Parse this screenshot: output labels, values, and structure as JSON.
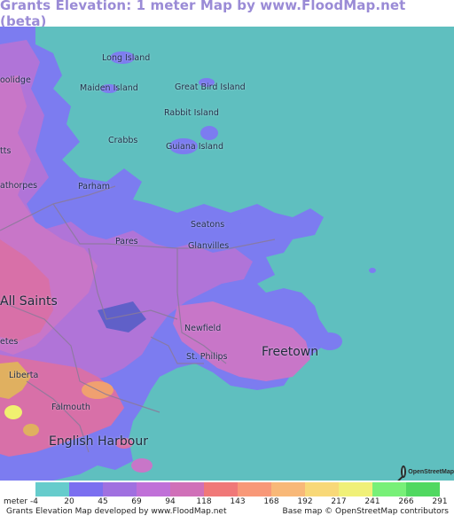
{
  "title": "Grants Elevation: 1 meter Map by www.FloodMap.net (beta)",
  "colors": {
    "sea": "#5fbfbf",
    "lowland": "#7c7cf0",
    "mid": "#b074d8",
    "upper": "#c876c8",
    "highland": "#d870a8",
    "peak": "#e0b060",
    "summit": "#f0f070"
  },
  "places": [
    {
      "name": "Long Island",
      "size": "small"
    },
    {
      "name": "Maiden Island",
      "size": "small"
    },
    {
      "name": "Great Bird Island",
      "size": "small"
    },
    {
      "name": "Rabbit Island",
      "size": "small"
    },
    {
      "name": "Crabbs",
      "size": "small"
    },
    {
      "name": "Guiana Island",
      "size": "small"
    },
    {
      "name": "Parham",
      "size": "small"
    },
    {
      "name": "Seatons",
      "size": "small"
    },
    {
      "name": "Pares",
      "size": "small"
    },
    {
      "name": "Glanvilles",
      "size": "small"
    },
    {
      "name": "All Saints",
      "size": "large"
    },
    {
      "name": "Newfield",
      "size": "small"
    },
    {
      "name": "Freetown",
      "size": "large"
    },
    {
      "name": "St. Philips",
      "size": "small"
    },
    {
      "name": "Liberta",
      "size": "small"
    },
    {
      "name": "Falmouth",
      "size": "small"
    },
    {
      "name": "English Harbour",
      "size": "large"
    },
    {
      "name": "oolidge",
      "size": "small"
    },
    {
      "name": "tts",
      "size": "small"
    },
    {
      "name": "athorpes",
      "size": "small"
    },
    {
      "name": "etes",
      "size": "small"
    }
  ],
  "osm_logo_text": "OpenStreetMap",
  "legend": {
    "unit_label": "meter",
    "ticks": [
      "-4",
      "20",
      "45",
      "69",
      "94",
      "118",
      "143",
      "168",
      "192",
      "217",
      "241",
      "266",
      "291"
    ],
    "swatch_colors": [
      "#66cccc",
      "#7b6ff0",
      "#a070e0",
      "#c070d8",
      "#d070b8",
      "#f07878",
      "#f89878",
      "#f8b878",
      "#f8d878",
      "#f0f078",
      "#78f078",
      "#50d860"
    ],
    "credit_left": "Grants Elevation Map developed by www.FloodMap.net",
    "credit_right": "Base map © OpenStreetMap contributors"
  }
}
